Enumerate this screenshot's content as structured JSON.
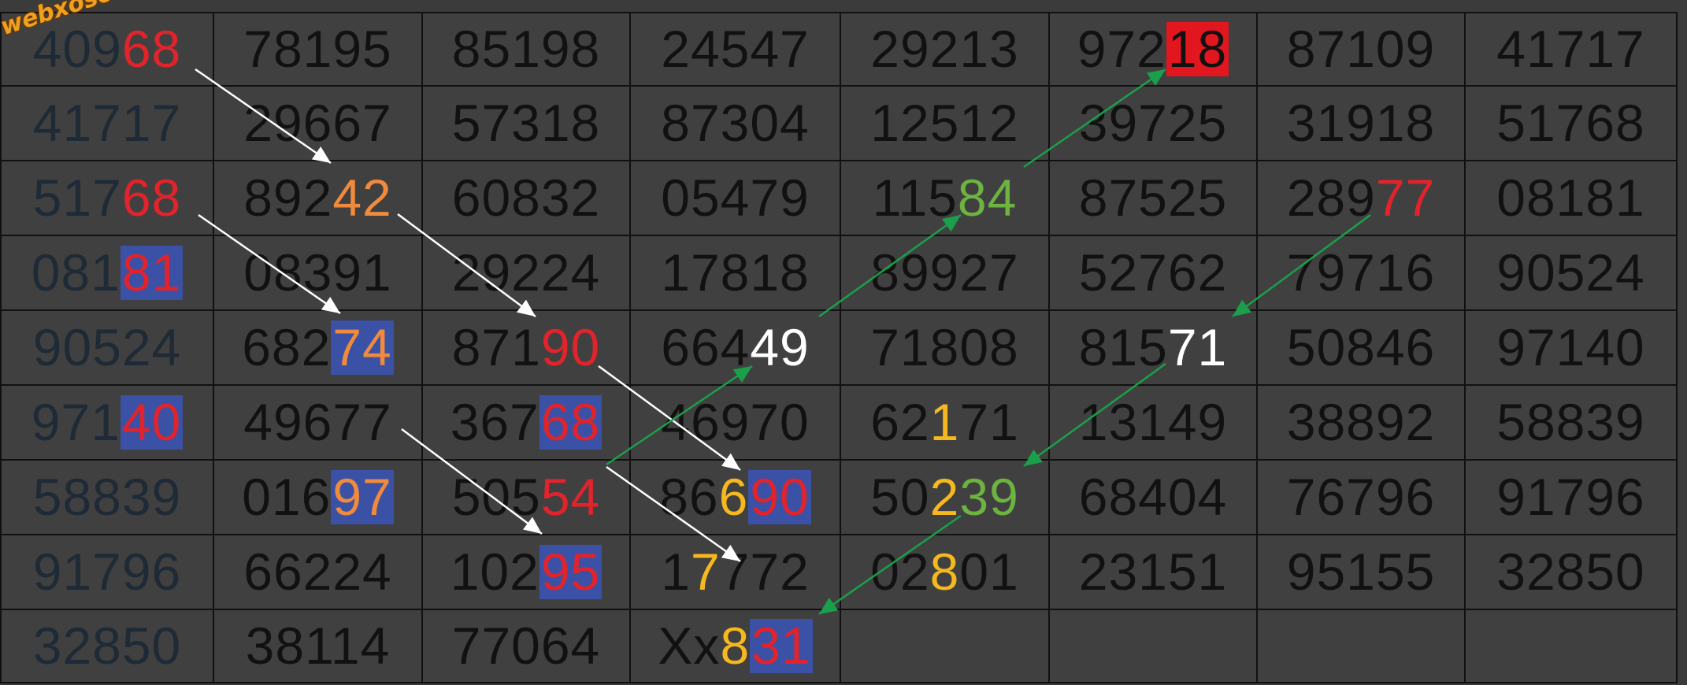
{
  "brand": "webxoso.net",
  "colors": {
    "red": "#e1232b",
    "orange": "#f08a3c",
    "green": "#6cb33f",
    "yellow": "#f6b81f",
    "white": "#ffffff",
    "blue_box": "#3a51a6",
    "red_box": "#e1161f",
    "arrow_white": "#ffffff",
    "arrow_green": "#1aa04a"
  },
  "grid": [
    [
      {
        "segs": [
          {
            "t": "409"
          },
          {
            "t": "68",
            "c": "red"
          }
        ]
      },
      {
        "segs": [
          {
            "t": "78195"
          }
        ]
      },
      {
        "segs": [
          {
            "t": "85198"
          }
        ]
      },
      {
        "segs": [
          {
            "t": "24547"
          }
        ]
      },
      {
        "segs": [
          {
            "t": "29213"
          }
        ]
      },
      {
        "segs": [
          {
            "t": "972"
          },
          {
            "t": "18",
            "c": "plain",
            "bg": "red_box"
          }
        ]
      },
      {
        "segs": [
          {
            "t": "87109"
          }
        ]
      },
      {
        "segs": [
          {
            "t": "41717"
          }
        ]
      }
    ],
    [
      {
        "segs": [
          {
            "t": "41717"
          }
        ]
      },
      {
        "segs": [
          {
            "t": "29667"
          }
        ]
      },
      {
        "segs": [
          {
            "t": "57318"
          }
        ]
      },
      {
        "segs": [
          {
            "t": "87304"
          }
        ]
      },
      {
        "segs": [
          {
            "t": "12512"
          }
        ]
      },
      {
        "segs": [
          {
            "t": "39725"
          }
        ]
      },
      {
        "segs": [
          {
            "t": "31918"
          }
        ]
      },
      {
        "segs": [
          {
            "t": "51768"
          }
        ]
      }
    ],
    [
      {
        "segs": [
          {
            "t": "517"
          },
          {
            "t": "68",
            "c": "red"
          }
        ]
      },
      {
        "segs": [
          {
            "t": "892"
          },
          {
            "t": "42",
            "c": "orange"
          }
        ]
      },
      {
        "segs": [
          {
            "t": "60832"
          }
        ]
      },
      {
        "segs": [
          {
            "t": "05479"
          }
        ]
      },
      {
        "segs": [
          {
            "t": "115"
          },
          {
            "t": "84",
            "c": "green"
          }
        ]
      },
      {
        "segs": [
          {
            "t": "87525"
          }
        ]
      },
      {
        "segs": [
          {
            "t": "289"
          },
          {
            "t": "77",
            "c": "red"
          }
        ]
      },
      {
        "segs": [
          {
            "t": "08181"
          }
        ]
      }
    ],
    [
      {
        "segs": [
          {
            "t": "081"
          },
          {
            "t": "81",
            "c": "red",
            "bg": "blue_box"
          }
        ]
      },
      {
        "segs": [
          {
            "t": "08391"
          }
        ]
      },
      {
        "segs": [
          {
            "t": "29224"
          }
        ]
      },
      {
        "segs": [
          {
            "t": "17818"
          }
        ]
      },
      {
        "segs": [
          {
            "t": "89927"
          }
        ]
      },
      {
        "segs": [
          {
            "t": "52762"
          }
        ]
      },
      {
        "segs": [
          {
            "t": "79716"
          }
        ]
      },
      {
        "segs": [
          {
            "t": "90524"
          }
        ]
      }
    ],
    [
      {
        "segs": [
          {
            "t": "90524"
          }
        ]
      },
      {
        "segs": [
          {
            "t": "682"
          },
          {
            "t": "74",
            "c": "orange",
            "bg": "blue_box"
          }
        ]
      },
      {
        "segs": [
          {
            "t": "871"
          },
          {
            "t": "90",
            "c": "red"
          }
        ]
      },
      {
        "segs": [
          {
            "t": "664"
          },
          {
            "t": "49",
            "c": "white"
          }
        ]
      },
      {
        "segs": [
          {
            "t": "71808"
          }
        ]
      },
      {
        "segs": [
          {
            "t": "815"
          },
          {
            "t": "71",
            "c": "white"
          }
        ]
      },
      {
        "segs": [
          {
            "t": "50846"
          }
        ]
      },
      {
        "segs": [
          {
            "t": "97140"
          }
        ]
      }
    ],
    [
      {
        "segs": [
          {
            "t": "971"
          },
          {
            "t": "40",
            "c": "red",
            "bg": "blue_box"
          }
        ]
      },
      {
        "segs": [
          {
            "t": "49677"
          }
        ]
      },
      {
        "segs": [
          {
            "t": "367"
          },
          {
            "t": "68",
            "c": "red",
            "bg": "blue_box"
          }
        ]
      },
      {
        "segs": [
          {
            "t": "46970"
          }
        ]
      },
      {
        "segs": [
          {
            "t": "62"
          },
          {
            "t": "1",
            "c": "yellow"
          },
          {
            "t": "71"
          }
        ]
      },
      {
        "segs": [
          {
            "t": "13149"
          }
        ]
      },
      {
        "segs": [
          {
            "t": "38892"
          }
        ]
      },
      {
        "segs": [
          {
            "t": "58839"
          }
        ]
      }
    ],
    [
      {
        "segs": [
          {
            "t": "58839"
          }
        ]
      },
      {
        "segs": [
          {
            "t": "016"
          },
          {
            "t": "97",
            "c": "orange",
            "bg": "blue_box"
          }
        ]
      },
      {
        "segs": [
          {
            "t": "505"
          },
          {
            "t": "54",
            "c": "red"
          }
        ]
      },
      {
        "segs": [
          {
            "t": "86"
          },
          {
            "t": "6",
            "c": "yellow"
          },
          {
            "t": "90",
            "c": "red",
            "bg": "blue_box"
          }
        ]
      },
      {
        "segs": [
          {
            "t": "50"
          },
          {
            "t": "2",
            "c": "yellow"
          },
          {
            "t": "39",
            "c": "green"
          }
        ]
      },
      {
        "segs": [
          {
            "t": "68404"
          }
        ]
      },
      {
        "segs": [
          {
            "t": "76796"
          }
        ]
      },
      {
        "segs": [
          {
            "t": "91796"
          }
        ]
      }
    ],
    [
      {
        "segs": [
          {
            "t": "91796"
          }
        ]
      },
      {
        "segs": [
          {
            "t": "66224"
          }
        ]
      },
      {
        "segs": [
          {
            "t": "102"
          },
          {
            "t": "95",
            "c": "red",
            "bg": "blue_box"
          }
        ]
      },
      {
        "segs": [
          {
            "t": "1"
          },
          {
            "t": "7",
            "c": "yellow"
          },
          {
            "t": "772"
          }
        ]
      },
      {
        "segs": [
          {
            "t": "02"
          },
          {
            "t": "8",
            "c": "yellow"
          },
          {
            "t": "01"
          }
        ]
      },
      {
        "segs": [
          {
            "t": "23151"
          }
        ]
      },
      {
        "segs": [
          {
            "t": "95155"
          }
        ]
      },
      {
        "segs": [
          {
            "t": "32850"
          }
        ]
      }
    ],
    [
      {
        "segs": [
          {
            "t": "32850"
          }
        ]
      },
      {
        "segs": [
          {
            "t": "38114"
          }
        ]
      },
      {
        "segs": [
          {
            "t": "77064"
          }
        ]
      },
      {
        "segs": [
          {
            "t": "Xx"
          },
          {
            "t": "8",
            "c": "yellow"
          },
          {
            "t": "31",
            "c": "red",
            "bg": "blue_box"
          }
        ]
      },
      {
        "segs": []
      },
      {
        "segs": []
      },
      {
        "segs": []
      },
      {
        "segs": []
      }
    ]
  ],
  "arrows": [
    {
      "from": [
        0,
        0
      ],
      "to": [
        2,
        1
      ],
      "color": "arrow_white"
    },
    {
      "from": [
        2,
        1
      ],
      "to": [
        4,
        2
      ],
      "color": "arrow_white"
    },
    {
      "from": [
        4,
        2
      ],
      "to": [
        6,
        3
      ],
      "color": "arrow_white"
    },
    {
      "from": [
        2,
        0
      ],
      "to": [
        4,
        1
      ],
      "color": "arrow_white"
    },
    {
      "from": [
        4,
        1
      ],
      "to": [
        6,
        2
      ],
      "color": "arrow_white"
    },
    {
      "from": [
        6,
        2
      ],
      "to": [
        8,
        3
      ],
      "color": "arrow_white"
    },
    {
      "from": [
        6,
        2
      ],
      "to": [
        4,
        3
      ],
      "color": "arrow_green"
    },
    {
      "from": [
        4,
        3
      ],
      "to": [
        2,
        4
      ],
      "color": "arrow_green"
    },
    {
      "from": [
        2,
        4
      ],
      "to": [
        0,
        5
      ],
      "color": "arrow_green"
    },
    {
      "from": [
        2,
        6
      ],
      "to": [
        4,
        5
      ],
      "color": "arrow_green"
    },
    {
      "from": [
        4,
        5
      ],
      "to": [
        6,
        4
      ],
      "color": "arrow_green"
    },
    {
      "from": [
        6,
        4
      ],
      "to": [
        8,
        3
      ],
      "color": "arrow_green"
    }
  ]
}
